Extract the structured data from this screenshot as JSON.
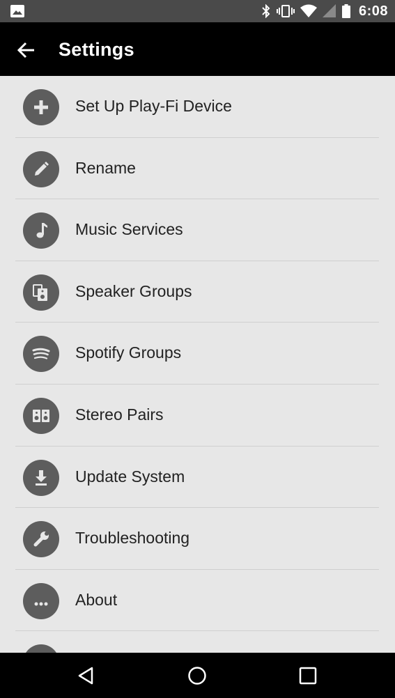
{
  "status_bar": {
    "time": "6:08",
    "icons": [
      "image-icon",
      "bluetooth-icon",
      "vibrate-icon",
      "wifi-icon",
      "signal-icon",
      "battery-icon"
    ]
  },
  "app_bar": {
    "title": "Settings",
    "back_icon": "arrow-left-icon"
  },
  "settings": {
    "items": [
      {
        "label": "Set Up Play-Fi Device",
        "icon": "plus-icon"
      },
      {
        "label": "Rename",
        "icon": "pencil-icon"
      },
      {
        "label": "Music Services",
        "icon": "music-note-icon"
      },
      {
        "label": "Speaker Groups",
        "icon": "speaker-group-icon"
      },
      {
        "label": "Spotify Groups",
        "icon": "spotify-icon"
      },
      {
        "label": "Stereo Pairs",
        "icon": "stereo-pair-icon"
      },
      {
        "label": "Update System",
        "icon": "download-icon"
      },
      {
        "label": "Troubleshooting",
        "icon": "wrench-icon"
      },
      {
        "label": "About",
        "icon": "more-dots-icon"
      }
    ]
  },
  "nav_bar": {
    "icons": [
      "back-triangle-icon",
      "home-circle-icon",
      "recents-square-icon"
    ]
  },
  "colors": {
    "status_bar": "#4a4a4a",
    "app_bar": "#000000",
    "list_bg": "#e7e7e7",
    "icon_circle": "#5d5d5d",
    "divider": "#cfcfcf"
  }
}
